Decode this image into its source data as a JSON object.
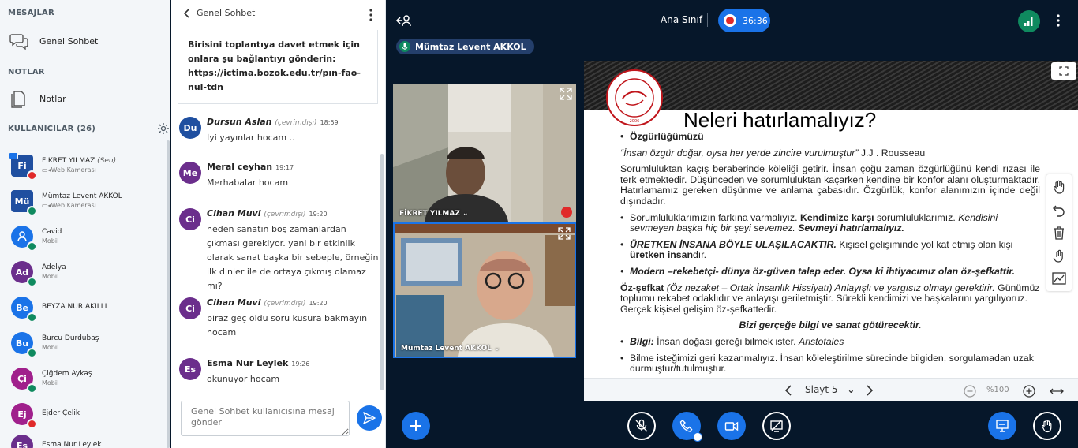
{
  "left": {
    "messages_head": "MESAJLAR",
    "public_chat": "Genel Sohbet",
    "notes_head": "NOTLAR",
    "notes": "Notlar",
    "users_head": "KULLANICILAR (26)",
    "users": [
      {
        "initials": "Fi",
        "name": "FİKRET YILMAZ",
        "you": "(Sen)",
        "sub": "Web Kamerası",
        "color": "#1f4fa0",
        "square": true,
        "badge": "red"
      },
      {
        "initials": "Mü",
        "name": "Mümtaz Levent AKKOL",
        "sub": "Web Kamerası",
        "color": "#1f4fa0",
        "square": true,
        "badge": "green"
      },
      {
        "initials": "",
        "name": "Cavid",
        "sub": "Mobil",
        "color": "#1a73e8",
        "badge": "green"
      },
      {
        "initials": "Ad",
        "name": "Adelya",
        "sub": "Mobil",
        "color": "#6b2e8c",
        "badge": "green"
      },
      {
        "initials": "Be",
        "name": "BEYZA NUR AKILLI",
        "sub": "",
        "color": "#1a73e8",
        "badge": "green"
      },
      {
        "initials": "Bu",
        "name": "Burcu Durdubaş",
        "sub": "Mobil",
        "color": "#1a73e8",
        "badge": "green"
      },
      {
        "initials": "Çi",
        "name": "Çiğdem Aykaş",
        "sub": "Mobil",
        "color": "#a0208c",
        "badge": "green"
      },
      {
        "initials": "Ej",
        "name": "Ejder Çelik",
        "sub": "",
        "color": "#a0208c",
        "badge": "red"
      },
      {
        "initials": "Es",
        "name": "Esma Nur Leylek",
        "sub": "",
        "color": "#6b2e8c",
        "badge": ""
      }
    ]
  },
  "chat": {
    "title": "Genel Sohbet",
    "welcome": "Birisini toplantıya davet etmek için onlara şu bağlantıyı gönderin: https://ictima.bozok.edu.tr/pın-fao-nul-tdn",
    "offline_label": "(çevrimdışı)",
    "messages": [
      {
        "initials": "Du",
        "color": "#1f4fa0",
        "name": "Dursun Aslan",
        "offline": true,
        "time": "18:59",
        "text": "İyi yayınlar hocam .."
      },
      {
        "initials": "Me",
        "color": "#6b2e8c",
        "name": "Meral ceyhan",
        "offline": false,
        "time": "19:17",
        "text": "Merhabalar hocam"
      },
      {
        "initials": "Ci",
        "color": "#6b2e8c",
        "name": "Cihan Muvi",
        "offline": true,
        "time": "19:20",
        "text": "neden sanatın boş zamanlardan çıkması gerekiyor. yani bir etkinlik olarak sanat başka bir sebeple, örneğin ilk dinler ile de ortaya çıkmış olamaz mı?"
      },
      {
        "initials": "Ci",
        "color": "#6b2e8c",
        "name": "Cihan Muvi",
        "offline": true,
        "time": "19:20",
        "text": "biraz geç oldu soru kusura bakmayın hocam"
      },
      {
        "initials": "Es",
        "color": "#6b2e8c",
        "name": "Esma Nur Leylek",
        "offline": false,
        "time": "19:26",
        "text": "okunuyor hocam"
      }
    ],
    "input_placeholder": "Genel Sohbet kullanıcısına mesaj gönder"
  },
  "main": {
    "room_name": "Ana Sınıf",
    "recording_time": "36:36",
    "talker": "Mümtaz Levent AKKOL",
    "videos": [
      {
        "name": "FİKRET YILMAZ"
      },
      {
        "name": "Mümtaz Levent AKKOL"
      }
    ]
  },
  "slide": {
    "title": "Neleri hatırlamalıyız?",
    "logo_text": "YOZGAT BOZOK ÜNİVERSİTESİ 2006",
    "b1": "Özgürlüğümüzü",
    "quote": "“İnsan özgür doğar, oysa her yerde zincire vurulmuştur”",
    "quote_author": " J.J . Rousseau",
    "para1": "Sorumluluktan kaçış beraberinde köleliği getirir. İnsan çoğu zaman özgürlüğünü kendi rızası ile terk etmektedir. Düşünceden ve sorumluluktan kaçarken kendine bir konfor alanı oluşturmaktadır. Hatırlamamız gereken düşünme ve anlama çabasıdır. Özgürlük, konfor alanımızın içinde değil dışındadır.",
    "b2a": "Sorumluluklarımızın farkına varmalıyız. ",
    "b2b": "Kendimize karşı",
    "b2c": " sorumluluklarımız. ",
    "b2d": "Kendisini sevmeyen başka hiç bir şeyi sevemez. ",
    "b2e": "Sevmeyi hatırlamalıyız.",
    "b3a": "ÜRETKEN İNSANA BÖYLE ULAŞILACAKTIR.",
    "b3b": " Kişisel gelişiminde yol kat etmiş olan kişi ",
    "b3c": "üretken insan",
    "b3d": "dır.",
    "b4": "Modern –rekebetçi- dünya öz-güven talep eder. Oysa ki ihtiyacımız olan öz-şefkattir.",
    "p2a": "Öz-şefkat",
    "p2b": " (Öz nezaket – Ortak İnsanlık Hissiyatı) Anlayışlı  ve yargısız olmayı gerektirir.",
    "p2c": " Günümüz toplumu rekabet odaklıdır ve anlayışı geriletmiştir. Sürekli kendimizi ve başkalarını yargılıyoruz. Gerçek kişisel gelişim öz-şefkattedir.",
    "center": "Bizi gerçeğe bilgi ve sanat götürecektir.",
    "b5a": "Bilgi:",
    "b5b": " İnsan doğası gereği bilmek ister. ",
    "b5c": "Aristotales",
    "b6": "Bilme isteğimizi geri kazanmalıyız. İnsan köleleştirilme sürecinde bilgiden, sorgulamadan uzak durmuştur/tutulmuştur.",
    "slide_select": "Slayt 5",
    "zoom": "%100"
  },
  "colors": {
    "accent": "#1a73e8",
    "bg": "#06172a",
    "online": "#0f8a5f",
    "muted": "#e02a2a"
  }
}
